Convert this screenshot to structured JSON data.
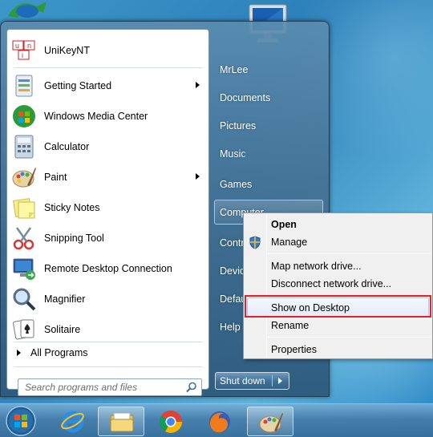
{
  "start_menu": {
    "pinned_programs": [
      {
        "label": "UniKeyNT",
        "icon": "unikey-icon",
        "has_submenu": false
      },
      {
        "label": "Getting Started",
        "icon": "getting-started-icon",
        "has_submenu": true
      },
      {
        "label": "Windows Media Center",
        "icon": "media-center-icon",
        "has_submenu": false
      },
      {
        "label": "Calculator",
        "icon": "calculator-icon",
        "has_submenu": false
      },
      {
        "label": "Paint",
        "icon": "paint-icon",
        "has_submenu": true
      },
      {
        "label": "Sticky Notes",
        "icon": "sticky-notes-icon",
        "has_submenu": false
      },
      {
        "label": "Snipping Tool",
        "icon": "snipping-tool-icon",
        "has_submenu": false
      },
      {
        "label": "Remote Desktop Connection",
        "icon": "remote-desktop-icon",
        "has_submenu": false
      },
      {
        "label": "Magnifier",
        "icon": "magnifier-icon",
        "has_submenu": false
      },
      {
        "label": "Solitaire",
        "icon": "solitaire-icon",
        "has_submenu": false
      }
    ],
    "all_programs_label": "All Programs",
    "search_placeholder": "Search programs and files",
    "right_items": [
      "MrLee",
      "Documents",
      "Pictures",
      "Music",
      "Games",
      "Computer",
      "Contr",
      "Devic",
      "Defau",
      "Help"
    ],
    "shutdown_label": "Shut down"
  },
  "context_menu": {
    "items": [
      {
        "label": "Open",
        "bold": true
      },
      {
        "label": "Manage",
        "icon": "uac-shield-icon"
      },
      {
        "label": "Map network drive..."
      },
      {
        "label": "Disconnect network drive..."
      },
      {
        "label": "Show on Desktop",
        "highlighted": true
      },
      {
        "label": "Rename"
      },
      {
        "label": "Properties"
      }
    ]
  },
  "taskbar": {
    "buttons": [
      "internet-explorer-icon",
      "windows-explorer-icon",
      "chrome-icon",
      "firefox-icon",
      "paint-icon"
    ],
    "active": [
      1,
      4
    ]
  },
  "colors": {
    "highlight_box": "#e1222a",
    "accent": "#3f6f96"
  }
}
